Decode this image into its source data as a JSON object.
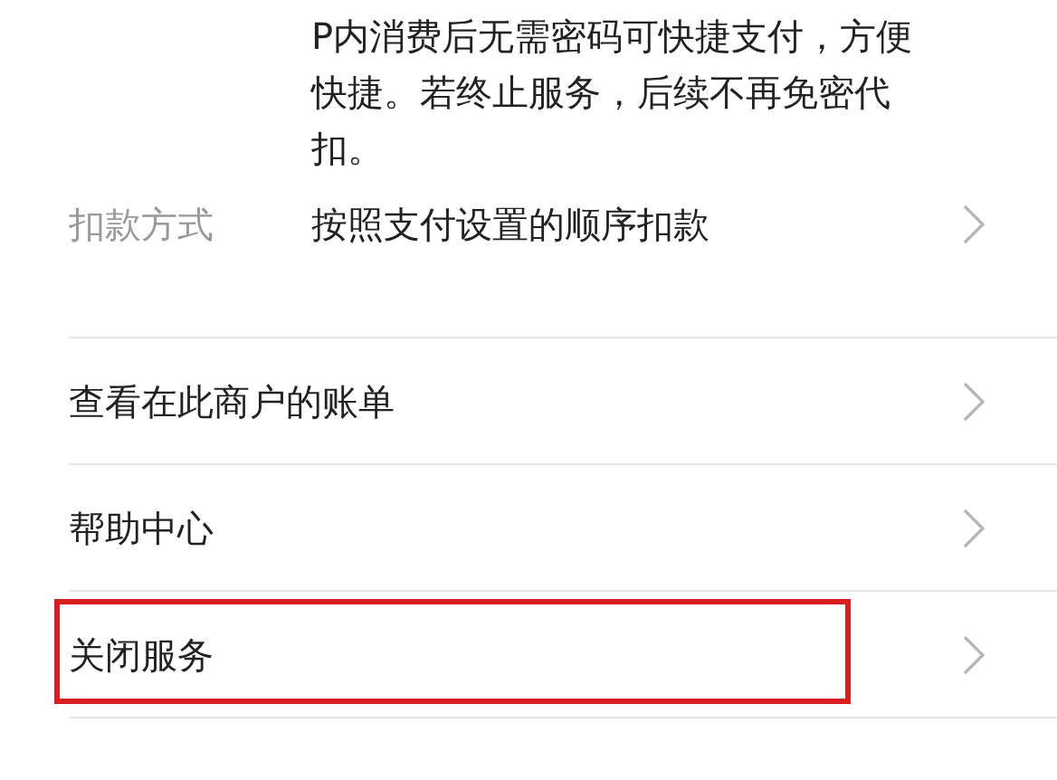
{
  "service_info": {
    "description_lines": [
      "P内消费后无需密码可快捷支付，方便",
      "快捷。若终止服务，后续不再免密代",
      "扣。"
    ],
    "payment_method": {
      "label": "扣款方式",
      "value": "按照支付设置的顺序扣款"
    }
  },
  "menu_items": [
    {
      "label": "查看在此商户的账单",
      "highlighted": false
    },
    {
      "label": "帮助中心",
      "highlighted": false
    },
    {
      "label": "关闭服务",
      "highlighted": true
    }
  ]
}
